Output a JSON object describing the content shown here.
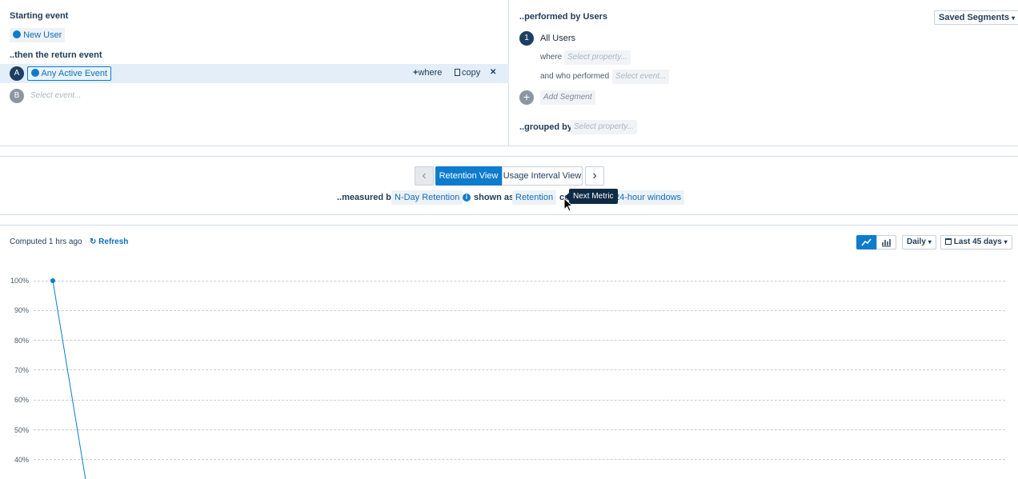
{
  "query": {
    "starting_event_label": "Starting event",
    "starting_event": "New User",
    "return_event_label": "..then the return event",
    "event_a_badge": "A",
    "event_a": "Any Active Event",
    "where_label": "where",
    "copy_label": "copy",
    "close_glyph": "✕",
    "event_b_badge": "B",
    "event_b_placeholder": "Select event..."
  },
  "segments": {
    "title": "..performed by Users",
    "saved_segments": "Saved Segments",
    "segment_badge": "1",
    "segment_name": "All Users",
    "where_label": "where",
    "where_placeholder": "Select property...",
    "who_performed_label": "and who performed",
    "who_performed_placeholder": "Select event...",
    "add_segment": "Add Segment",
    "grouped_by_label": "..grouped by",
    "grouped_by_placeholder": "Select property..."
  },
  "view": {
    "prev_glyph": "‹",
    "next_glyph": "›",
    "retention_view": "Retention View",
    "usage_interval_view": "Usage Interval View",
    "measured_by_label": "..measured by",
    "measured_by_value": "N-Day Retention",
    "shown_as_label": "shown as",
    "shown_as_value": "Retention",
    "calc_label_partial": "ca",
    "windows_value": "24-hour windows",
    "tooltip": "Next Metric"
  },
  "toolbar": {
    "computed": "Computed 1 hrs ago",
    "refresh": "Refresh",
    "interval": "Daily",
    "date_range": "Last 45 days",
    "line_chart_active": true
  },
  "colors": {
    "accent": "#0d7ccc",
    "selected_row": "#e3eef8",
    "dark_badge": "#1d3f63",
    "grey_badge": "#8c96a3"
  },
  "chart_data": {
    "type": "line",
    "title": "",
    "xlabel": "",
    "ylabel": "",
    "y_tick_labels": [
      "100%",
      "90%",
      "80%",
      "70%",
      "60%",
      "50%",
      "40%"
    ],
    "ylim_visible": [
      35,
      100
    ],
    "series": [
      {
        "values": [
          100,
          30
        ]
      }
    ],
    "x": [
      0,
      1
    ],
    "grid": true,
    "marker_on_first_point": true
  }
}
